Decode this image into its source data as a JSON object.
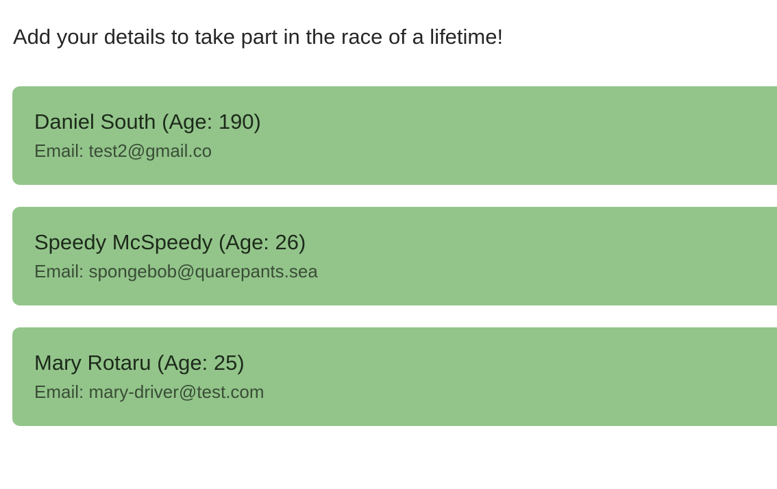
{
  "intro": {
    "text": "Add your details to take part in the race of a lifetime!"
  },
  "participants": [
    {
      "title": "Daniel South (Age: 190)",
      "email": "Email: test2@gmail.co"
    },
    {
      "title": "Speedy McSpeedy (Age: 26)",
      "email": "Email: spongebob@quarepants.sea"
    },
    {
      "title": "Mary Rotaru (Age: 25)",
      "email": "Email: mary-driver@test.com"
    }
  ],
  "colors": {
    "card_background": "#93c58b",
    "title_text": "#1d2a1a",
    "email_text": "#3a4d36"
  }
}
